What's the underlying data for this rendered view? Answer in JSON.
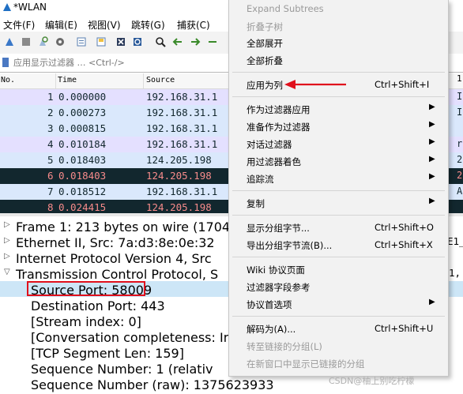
{
  "window": {
    "title": "*WLAN"
  },
  "menubar": [
    "文件(F)",
    "编辑(E)",
    "视图(V)",
    "跳转(G)",
    "捕获(C)"
  ],
  "filter": {
    "placeholder": "应用显示过滤器 … <Ctrl-/>"
  },
  "packet_list": {
    "columns": [
      "No.",
      "Time",
      "Source"
    ],
    "rows": [
      {
        "no": "1",
        "time": "0.000000",
        "source": "192.168.31.1",
        "style": "lavender"
      },
      {
        "no": "2",
        "time": "0.000273",
        "source": "192.168.31.1",
        "style": "blue"
      },
      {
        "no": "3",
        "time": "0.000815",
        "source": "192.168.31.1",
        "style": "blue"
      },
      {
        "no": "4",
        "time": "0.010184",
        "source": "192.168.31.1",
        "style": "lavender"
      },
      {
        "no": "5",
        "time": "0.018403",
        "source": "124.205.198",
        "style": "blue"
      },
      {
        "no": "6",
        "time": "0.018403",
        "source": "124.205.198",
        "style": "dark"
      },
      {
        "no": "7",
        "time": "0.018512",
        "source": "192.168.31.1",
        "style": "blue"
      },
      {
        "no": "8",
        "time": "0.024415",
        "source": "124.205.198",
        "style": "dark"
      }
    ]
  },
  "details": {
    "frame": "Frame 1: 213 bytes on wire (1704",
    "ethernet": "Ethernet II, Src: 7a:d3:8e:0e:32",
    "ip": "Internet Protocol Version 4, Src",
    "tcp": "Transmission Control Protocol, S",
    "source_port": "Source Port: 58009",
    "dest_port": "Destination Port: 443",
    "stream_index": "[Stream index: 0]",
    "conversation": "[Conversation completeness: In",
    "seg_len": "[TCP Segment Len: 159]",
    "seq_num": "Sequence Number: 1    (relativ",
    "seq_raw": "Sequence Number (raw): 1375623933"
  },
  "context_menu": {
    "expand_subtrees": "Expand Subtrees",
    "collapse_subtrees": "折叠子树",
    "expand_all": "全部展开",
    "collapse_all": "全部折叠",
    "apply_as_column": "应用为列",
    "apply_as_column_shortcut": "Ctrl+Shift+I",
    "apply_as_filter": "作为过滤器应用",
    "prepare_as_filter": "准备作为过滤器",
    "conversation_filter": "对话过滤器",
    "colorize_with_filter": "用过滤器着色",
    "follow_stream": "追踪流",
    "copy": "复制",
    "show_packet_bytes": "显示分组字节...",
    "show_packet_bytes_shortcut": "Ctrl+Shift+O",
    "export_packet_bytes": "导出分组字节流(B)...",
    "export_packet_bytes_shortcut": "Ctrl+Shift+X",
    "wiki_protocol_page": "Wiki 协议页面",
    "filter_field_reference": "过滤器字段参考",
    "protocol_preferences": "协议首选项",
    "decode_as": "解码为(A)...",
    "decode_as_shortcut": "Ctrl+Shift+U",
    "go_to_linked_packet": "转至链接的分组(L)",
    "show_linked_packet_new_window": "在新窗口中显示已链接的分组"
  },
  "right_peek": {
    "r1": "1",
    "r2": "I",
    "r3": "I",
    "r4": "r",
    "r5": "2",
    "r6": "2",
    "r7": "A",
    "d2": "E1_",
    "d4": "1,"
  },
  "watermark": "CSDN@柚上别吃柠檬"
}
